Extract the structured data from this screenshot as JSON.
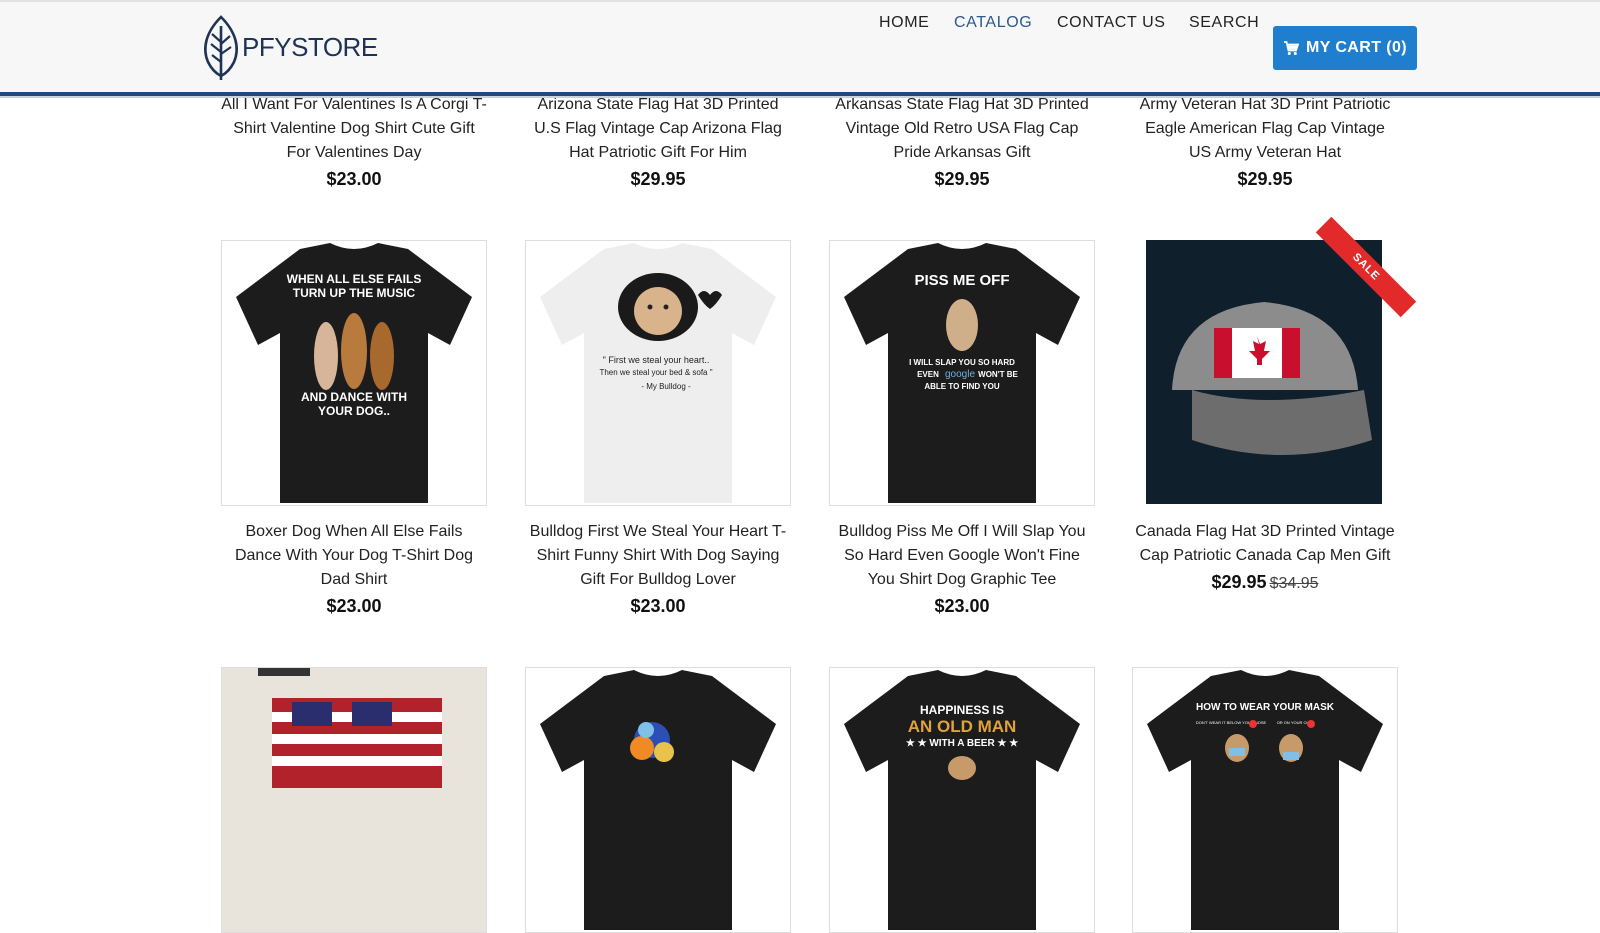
{
  "header": {
    "logo_text": "PFYSTORE",
    "nav": [
      "HOME",
      "CATALOG",
      "CONTACT US",
      "SEARCH"
    ],
    "active_nav": "CATALOG",
    "cart_label": "MY CART (0)"
  },
  "colors": {
    "accent": "#1f7fce",
    "brand": "#1e3355",
    "header_rule": "#1e4a79",
    "sale": "#e32a2a"
  },
  "products_row1": [
    {
      "title": "All I Want For Valentines Is A Corgi T-Shirt Valentine Dog Shirt Cute Gift For Valentines Day",
      "price": "$23.00"
    },
    {
      "title": "Arizona State Flag Hat 3D Printed U.S Flag Vintage Cap Arizona Flag Hat Patriotic Gift For Him",
      "price": "$29.95"
    },
    {
      "title": "Arkansas State Flag Hat 3D Printed Vintage Old Retro USA Flag Cap Pride Arkansas Gift",
      "price": "$29.95"
    },
    {
      "title": "Army Veteran Hat 3D Print Patriotic Eagle American Flag Cap Vintage US Army Veteran Hat",
      "price": "$29.95"
    }
  ],
  "products_row2": [
    {
      "title": "Boxer Dog When All Else Fails Dance With Your Dog T-Shirt Dog Dad Shirt",
      "price": "$23.00",
      "art": [
        "WHEN ALL ELSE FAILS",
        "TURN UP THE MUSIC",
        "AND DANCE WITH",
        "YOUR DOG.."
      ]
    },
    {
      "title": "Bulldog First We Steal Your Heart T-Shirt Funny Shirt With Dog Saying Gift For Bulldog Lover",
      "price": "$23.00",
      "art": [
        "\" First we steal your heart..",
        "Then we steal your bed & sofa \"",
        "-   My Bulldog   -"
      ]
    },
    {
      "title": "Bulldog Piss Me Off I Will Slap You So Hard Even Google Won't Fine You Shirt Dog Graphic Tee",
      "price": "$23.00",
      "art": [
        "PISS ME OFF",
        "I WILL SLAP YOU SO HARD",
        "EVEN",
        "google",
        "WON'T BE",
        "ABLE TO FIND YOU"
      ]
    },
    {
      "title": "Canada Flag Hat 3D Printed Vintage Cap Patriotic Canada Cap Men Gift",
      "price": "$29.95",
      "old_price": "$34.95",
      "badge": "SALE"
    }
  ],
  "products_row3_art": [
    [],
    [],
    [
      "HAPPINESS IS",
      "AN OLD MAN",
      "★ ★ WITH A BEER ★ ★"
    ],
    [
      "HOW TO WEAR YOUR MASK",
      "DON'T WEAR IT BELOW YOUR NOSE",
      "OR ON YOUR CHIN"
    ]
  ]
}
